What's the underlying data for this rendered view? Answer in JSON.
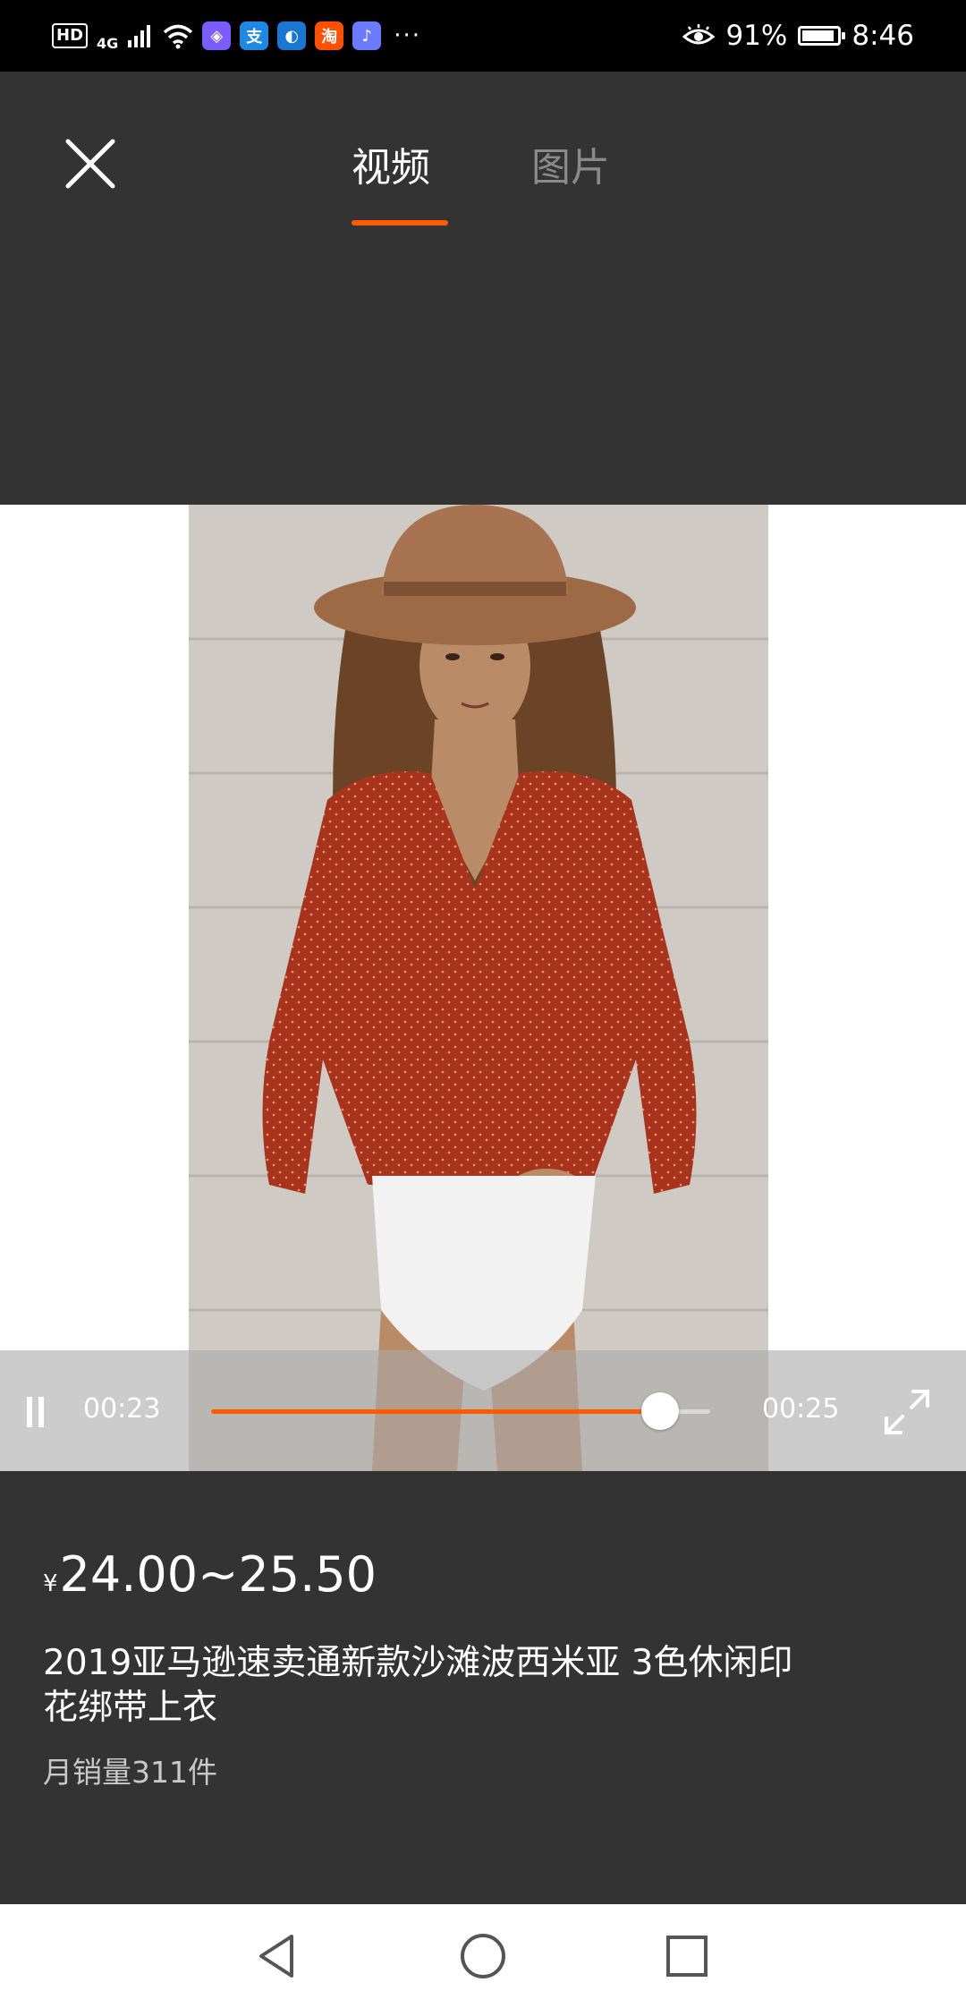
{
  "status_bar": {
    "hd_label": "HD",
    "network_label": "4G",
    "app_icons": [
      {
        "name": "cube-app-icon",
        "glyph": "◈",
        "color": "#7b5cff"
      },
      {
        "name": "alipay-icon",
        "glyph": "支",
        "color": "#1e88e5"
      },
      {
        "name": "browser-icon",
        "glyph": "◐",
        "color": "#1976d2"
      },
      {
        "name": "taobao-icon",
        "glyph": "淘",
        "color": "#ff5000"
      },
      {
        "name": "music-icon",
        "glyph": "♪",
        "color": "#6a7bff"
      }
    ],
    "more_label": "···",
    "battery": "91%",
    "battery_level": 0.91,
    "time": "8:46"
  },
  "header": {
    "tabs": [
      {
        "label": "视频",
        "active": true
      },
      {
        "label": "图片",
        "active": false
      }
    ],
    "accent_color": "#ff5a00"
  },
  "player": {
    "current_time": "00:23",
    "total_time": "00:25",
    "progress": 0.9,
    "state": "playing"
  },
  "product": {
    "currency": "¥",
    "price": "24.00~25.50",
    "title": "2019亚马逊速卖通新款沙滩波西米亚 3色休闲印花绑带上衣",
    "monthly_sales": "月销量311件"
  },
  "nav_bar": {
    "buttons": [
      "back",
      "home",
      "recents"
    ]
  }
}
